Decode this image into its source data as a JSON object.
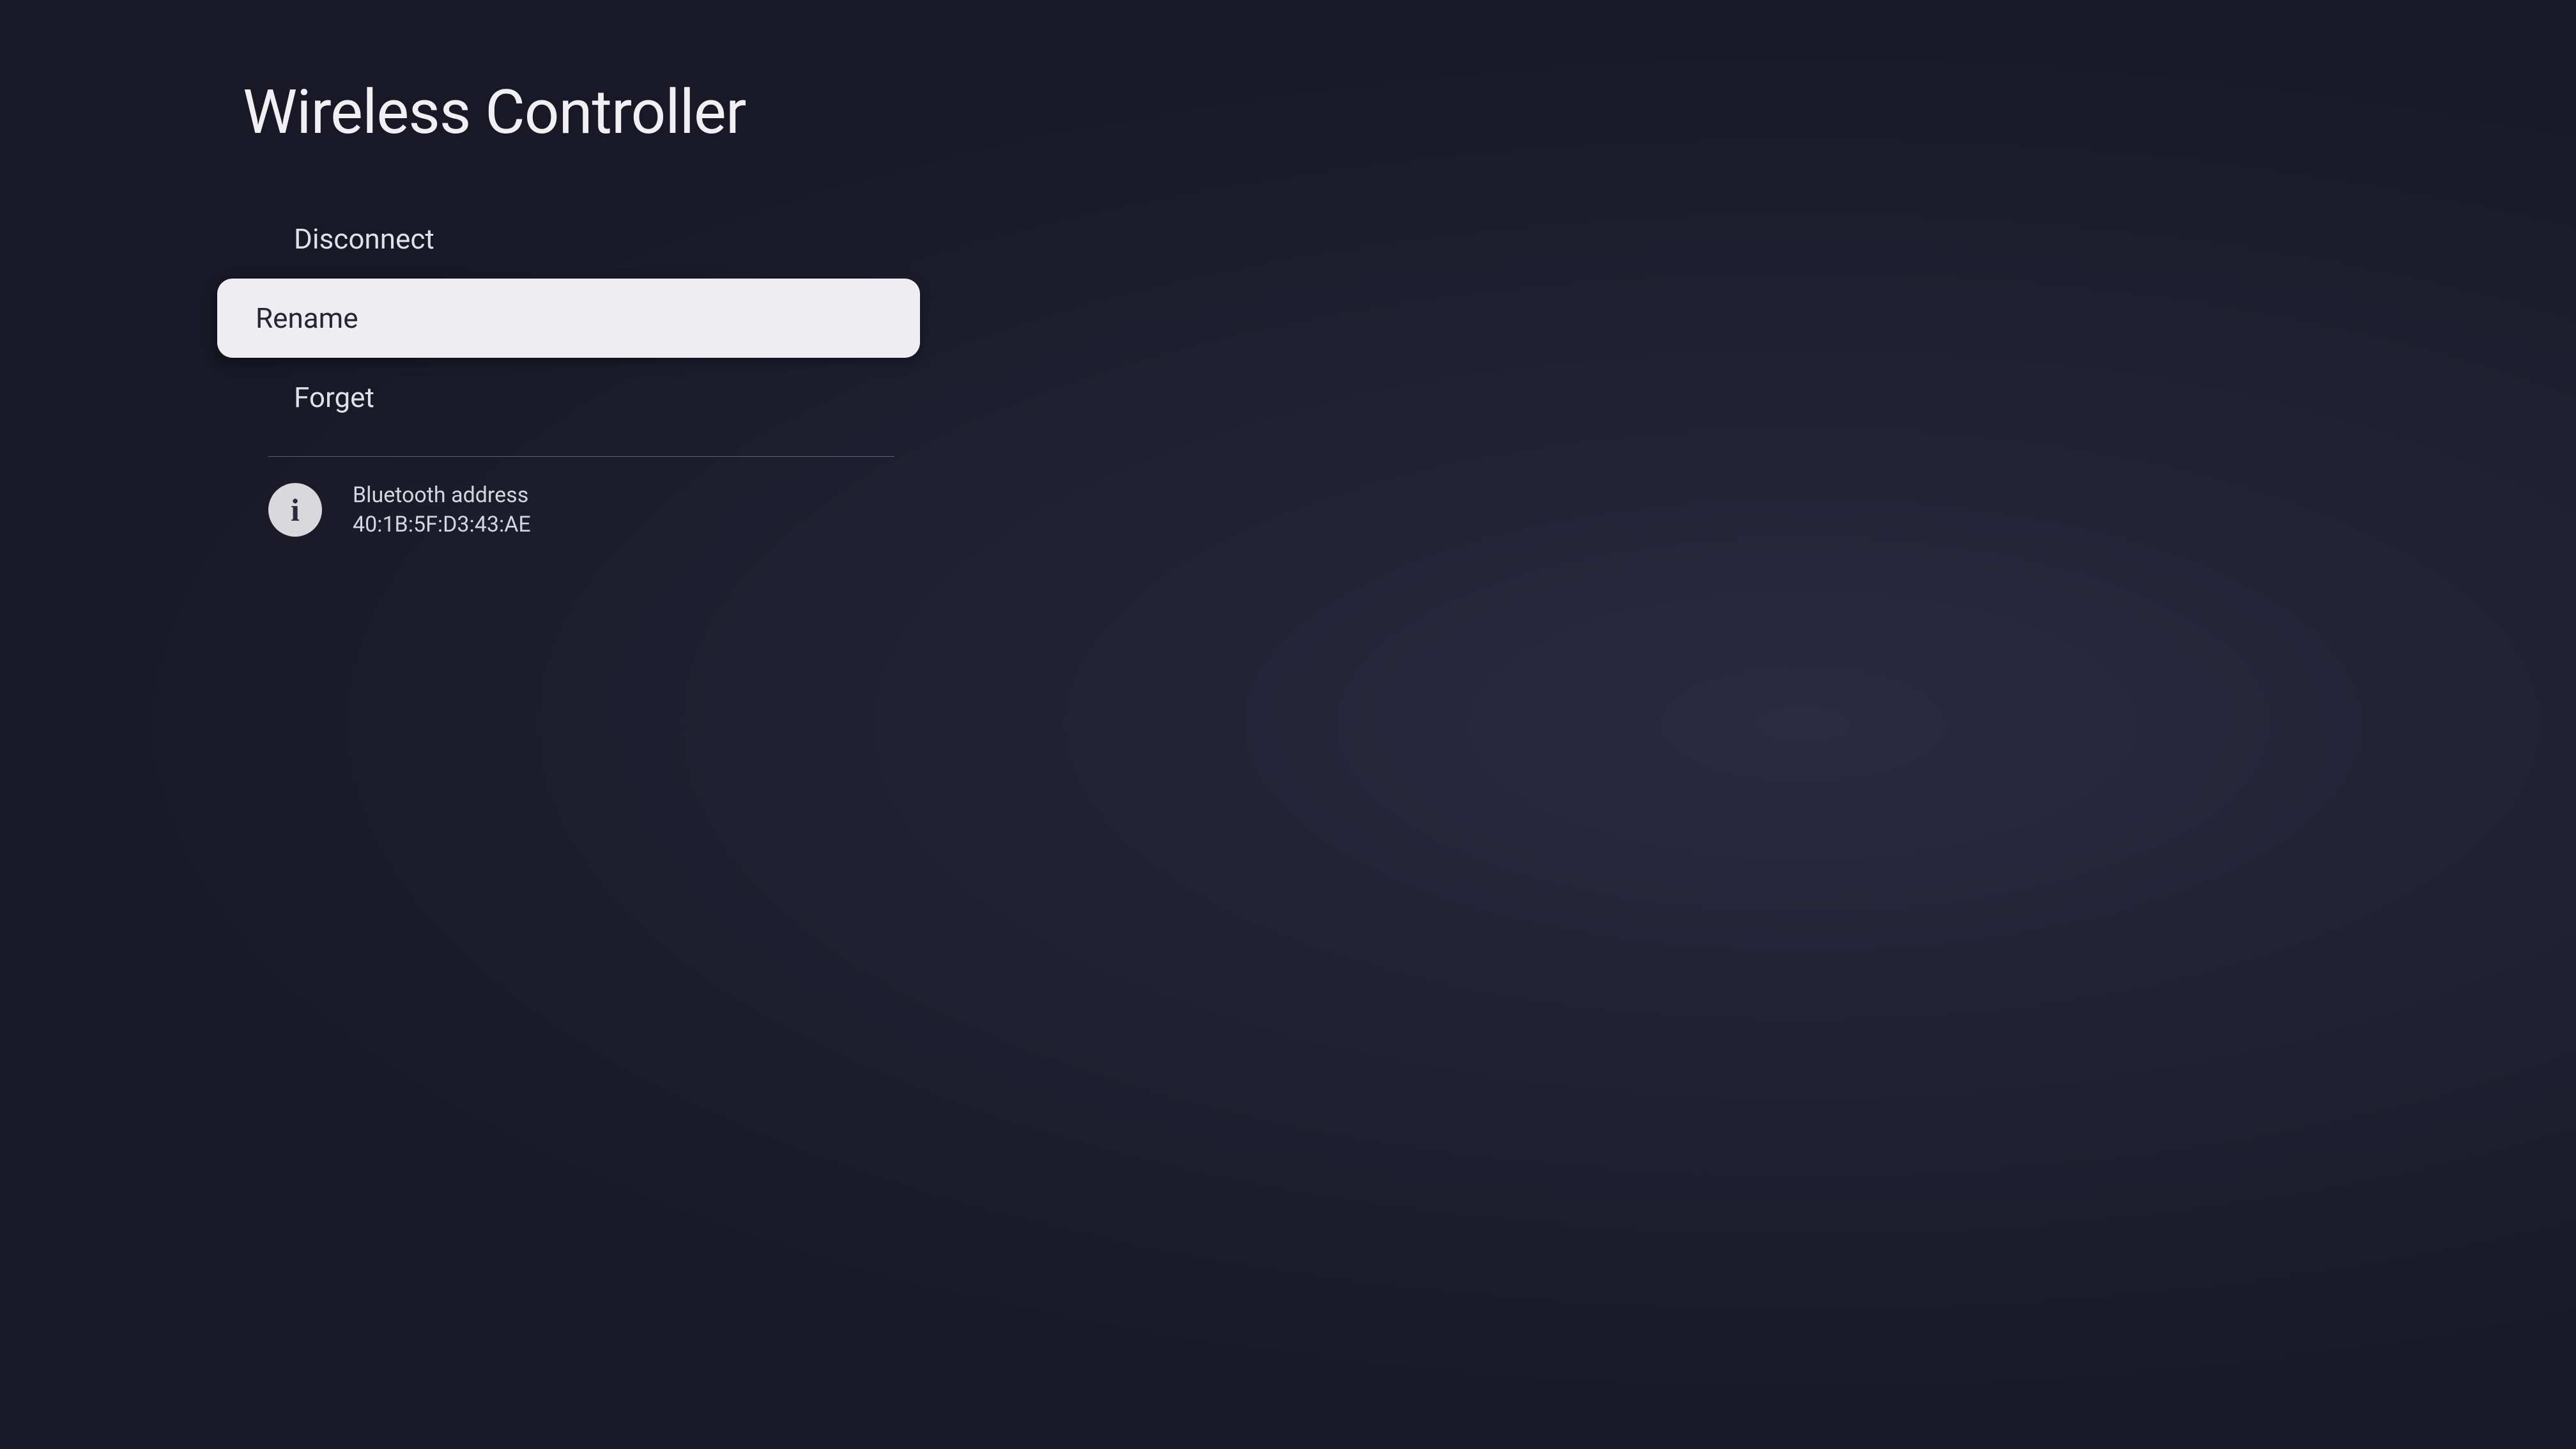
{
  "header": {
    "title": "Wireless Controller"
  },
  "menu": {
    "items": [
      {
        "label": "Disconnect",
        "selected": false
      },
      {
        "label": "Rename",
        "selected": true
      },
      {
        "label": "Forget",
        "selected": false
      }
    ]
  },
  "info": {
    "label": "Bluetooth address",
    "value": "40:1B:5F:D3:43:AE"
  }
}
